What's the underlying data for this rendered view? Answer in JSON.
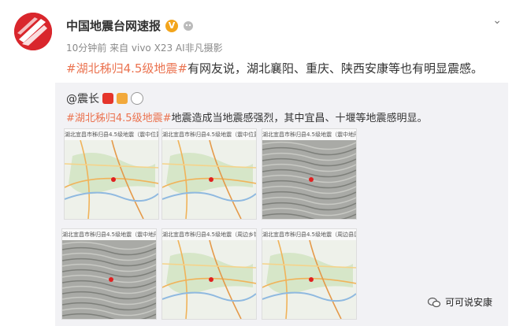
{
  "author": {
    "name": "中国地震台网速报",
    "verified_icon": "verified-badge-icon",
    "meta": "10分钟前 来自 vivo X23 AI非凡摄影"
  },
  "post": {
    "hashtag": "#湖北秭归4.5级地震#",
    "text": "有网友说，湖北襄阳、重庆、陕西安康等也有明显震感。"
  },
  "repost": {
    "author": "@震长",
    "hashtag": "#湖北秭归4.5级地震#",
    "text": "地震造成当地震感强烈，其中宜昌、十堰等地震感明显。",
    "images": [
      {
        "title": "湖北宜昌市秭归县4.5级地震（震中位置）",
        "style": "map"
      },
      {
        "title": "湖北宜昌市秭归县4.5级地震（震中位置）",
        "style": "map"
      },
      {
        "title": "湖北宜昌市秭归县4.5级地震（震中地形）",
        "style": "terrain"
      },
      {
        "title": "湖北宜昌市秭归县4.5级地震（震中地形）",
        "style": "terrain"
      },
      {
        "title": "湖北宜昌市秭归县4.5级地震（周边乡镇）",
        "style": "map"
      },
      {
        "title": "湖北宜昌市秭归县4.5级地震（周边县区）",
        "style": "map"
      }
    ]
  },
  "watermark": {
    "text": "可可说安康",
    "icon": "wechat-icon"
  },
  "colors": {
    "hashtag": "#eb7350",
    "brand": "#d9262c",
    "repost_bg": "#f2f2f5"
  }
}
